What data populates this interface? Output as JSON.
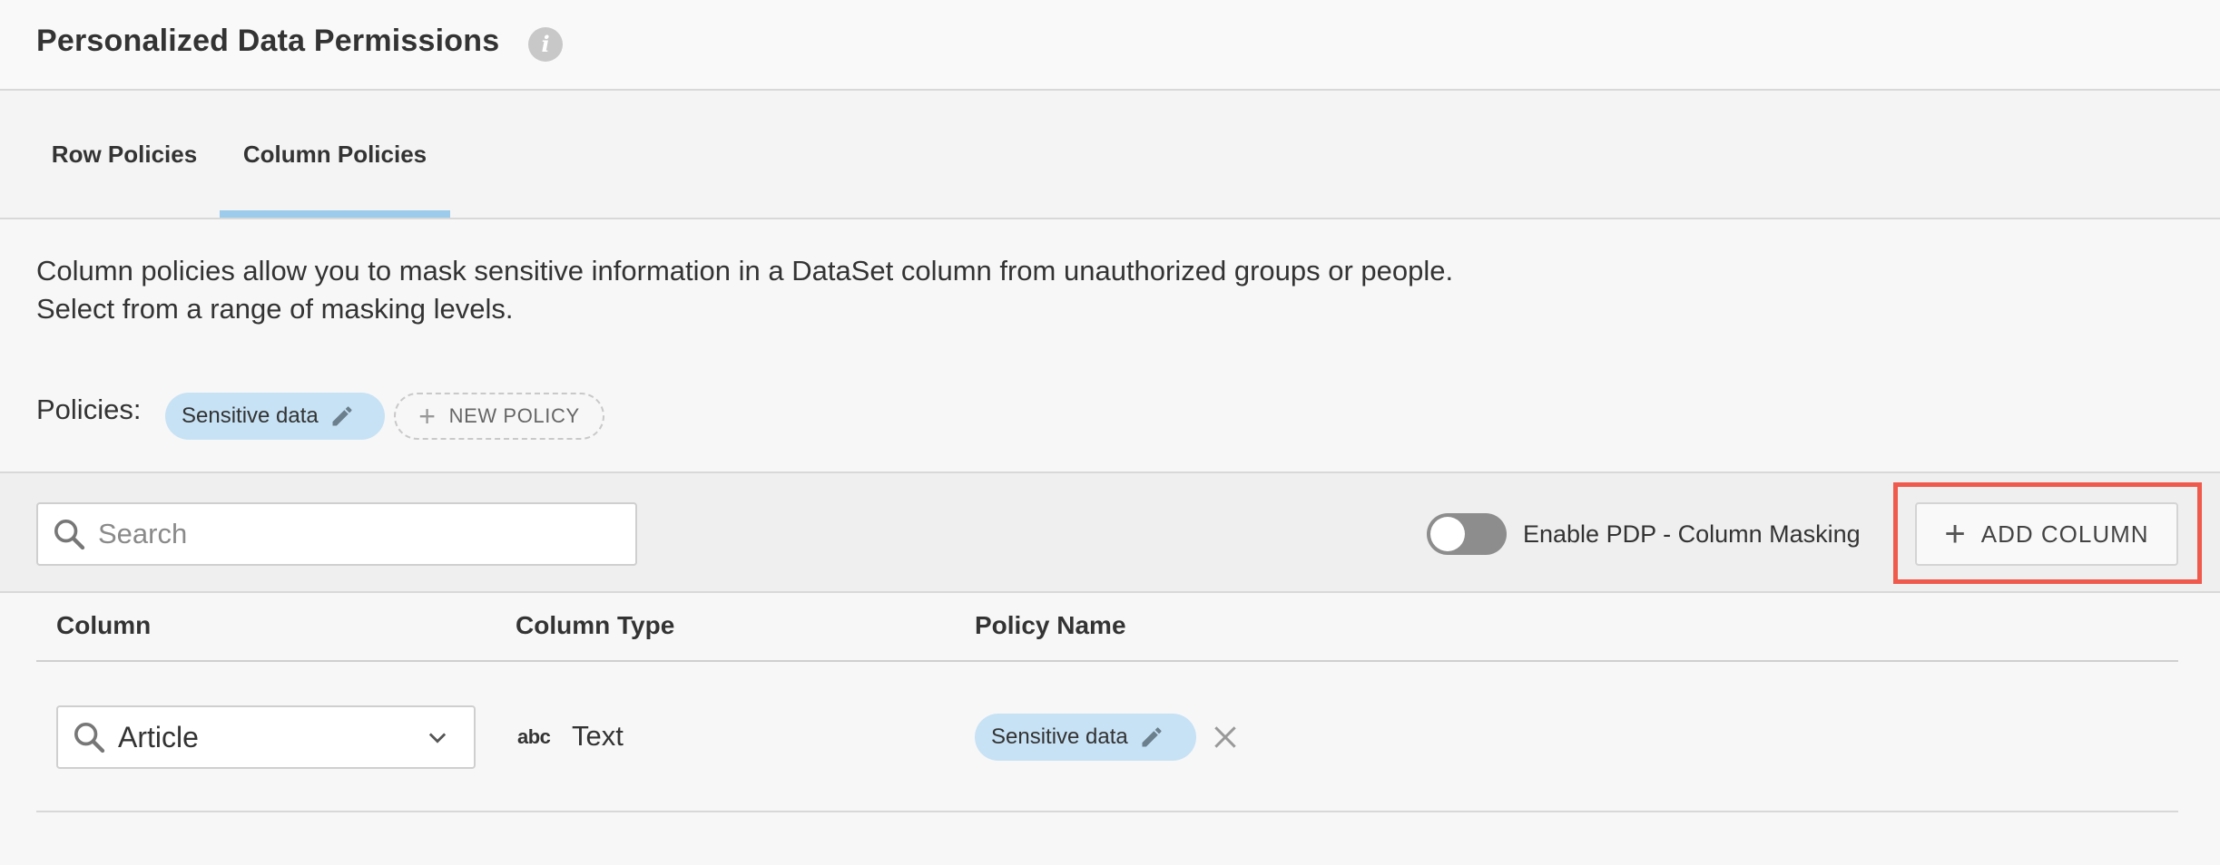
{
  "header": {
    "title": "Personalized Data Permissions",
    "info_icon": "info-icon"
  },
  "tabs": [
    {
      "label": "Row Policies",
      "active": false
    },
    {
      "label": "Column Policies",
      "active": true
    }
  ],
  "description": {
    "line1": "Column policies allow you to mask sensitive information in a DataSet column from unauthorized groups or people.",
    "line2": "Select from a range of masking levels."
  },
  "policies": {
    "label": "Policies:",
    "items": [
      {
        "name": "Sensitive data",
        "icon": "pencil-icon"
      }
    ],
    "new_policy_label": "NEW POLICY"
  },
  "toolbar": {
    "search_placeholder": "Search",
    "toggle_label": "Enable PDP - Column Masking",
    "toggle_on": false,
    "add_column_label": "ADD COLUMN"
  },
  "table": {
    "headers": {
      "column": "Column",
      "column_type": "Column Type",
      "policy_name": "Policy Name"
    },
    "rows": [
      {
        "column": "Article",
        "type_icon": "abc",
        "type": "Text",
        "policy": "Sensitive data"
      }
    ]
  },
  "colors": {
    "highlight": "#ef5a4c",
    "chip": "#c7e2f5",
    "tab_underline": "#9ccbeb",
    "toggle_off": "#8d8d8d"
  }
}
